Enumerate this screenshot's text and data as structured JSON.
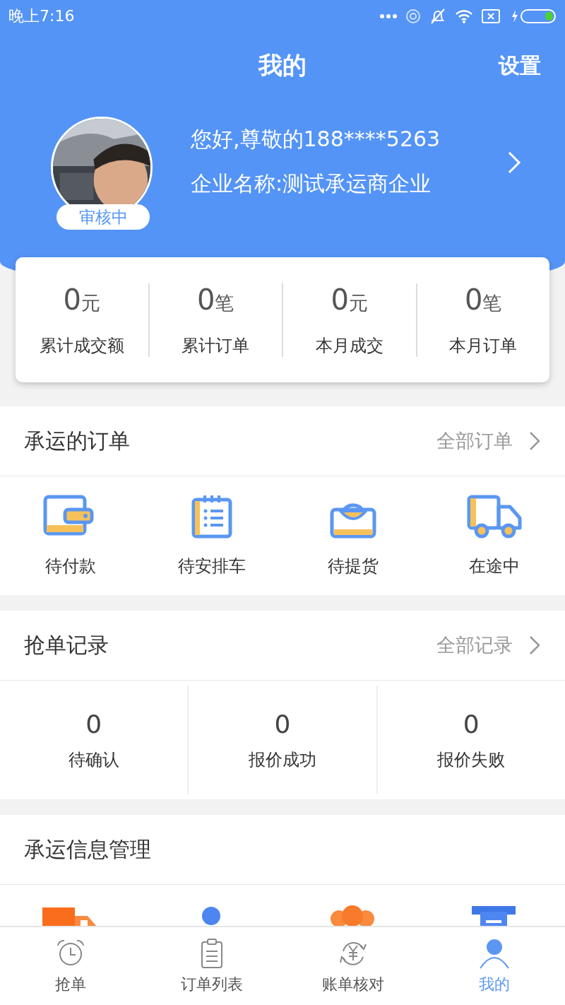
{
  "status_bar": {
    "time": "晚上7:16"
  },
  "header": {
    "title": "我的",
    "action": "设置"
  },
  "profile": {
    "greeting": "您好,尊敬的188****5263",
    "company": "企业名称:测试承运商企业",
    "badge": "审核中"
  },
  "stats": [
    {
      "value": "0",
      "unit": "元",
      "label": "累计成交额"
    },
    {
      "value": "0",
      "unit": "笔",
      "label": "累计订单"
    },
    {
      "value": "0",
      "unit": "元",
      "label": "本月成交"
    },
    {
      "value": "0",
      "unit": "笔",
      "label": "本月订单"
    }
  ],
  "orders": {
    "title": "承运的订单",
    "link": "全部订单",
    "items": [
      {
        "label": "待付款"
      },
      {
        "label": "待安排车"
      },
      {
        "label": "待提货"
      },
      {
        "label": "在途中"
      }
    ]
  },
  "bids": {
    "title": "抢单记录",
    "link": "全部记录",
    "items": [
      {
        "value": "0",
        "label": "待确认"
      },
      {
        "value": "0",
        "label": "报价成功"
      },
      {
        "value": "0",
        "label": "报价失败"
      }
    ]
  },
  "management": {
    "title": "承运信息管理"
  },
  "tab_bar": [
    {
      "label": "抢单",
      "selected": false
    },
    {
      "label": "订单列表",
      "selected": false
    },
    {
      "label": "账单核对",
      "selected": false
    },
    {
      "label": "我的",
      "selected": true
    }
  ]
}
